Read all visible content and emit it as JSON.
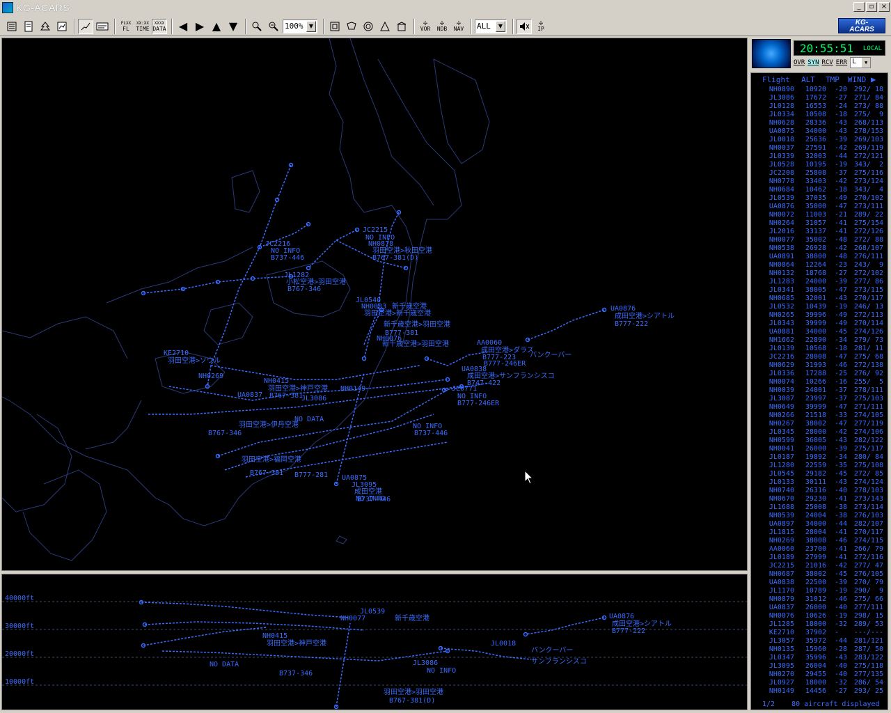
{
  "window": {
    "title": "KG-ACARS",
    "minimize": "_",
    "maximize": "▫",
    "close": "×"
  },
  "toolbar": {
    "fl_label": "FL",
    "fl_top": "FLXX",
    "time_label": "TIME",
    "time_top": "XX:XX",
    "data_label": "DATA",
    "data_top": "XXXX",
    "zoom_value": "100%",
    "filter_value": "ALL",
    "vor_label": "VOR",
    "ndb_label": "NDB",
    "nav_label": "NAV",
    "ip_label": "IP"
  },
  "logo": {
    "line1": "KG-",
    "line2": "ACARS"
  },
  "clock": {
    "time": "20:55:51",
    "mode": "LOCAL"
  },
  "status": {
    "ovr": "OVR",
    "syn": "SYN",
    "rcv": "RCV",
    "err": "ERR",
    "level": "L"
  },
  "flight_list": {
    "headers": {
      "flight": "Flight",
      "alt": "ALT",
      "tmp": "TMP",
      "wind": "WIND"
    },
    "rows": [
      [
        "NH0890",
        "10920",
        "-20",
        "292/ 18"
      ],
      [
        "JL3086",
        "17672",
        "-27",
        "271/ 84"
      ],
      [
        "JL0128",
        "16553",
        "-24",
        "273/ 88"
      ],
      [
        "JL0334",
        "10508",
        "-18",
        "275/  9"
      ],
      [
        "NH0628",
        "28336",
        "-43",
        "268/113"
      ],
      [
        "UA0875",
        "34000",
        "-43",
        "278/153"
      ],
      [
        "JL0018",
        "25636",
        "-39",
        "269/103"
      ],
      [
        "NH0037",
        "27591",
        "-42",
        "269/119"
      ],
      [
        "JL0339",
        "32003",
        "-44",
        "272/121"
      ],
      [
        "JL0528",
        "10195",
        "-19",
        "343/  2"
      ],
      [
        "JC2208",
        "25808",
        "-37",
        "275/116"
      ],
      [
        "NH0778",
        "33403",
        "-42",
        "273/124"
      ],
      [
        "NH0684",
        "10462",
        "-18",
        "343/  4"
      ],
      [
        "JL0539",
        "37035",
        "-49",
        "270/102"
      ],
      [
        "UA0876",
        "35000",
        "-47",
        "273/111"
      ],
      [
        "NH0072",
        "11003",
        "-21",
        "289/ 22"
      ],
      [
        "NH0264",
        "31057",
        "-41",
        "275/154"
      ],
      [
        "JL2016",
        "33137",
        "-41",
        "272/126"
      ],
      [
        "NH0077",
        "35002",
        "-48",
        "272/ 88"
      ],
      [
        "NH0538",
        "26928",
        "-42",
        "268/107"
      ],
      [
        "UA0891",
        "38000",
        "-48",
        "276/111"
      ],
      [
        "NH0864",
        "12264",
        "-23",
        "243/  9"
      ],
      [
        "NH0132",
        "18768",
        "-27",
        "272/102"
      ],
      [
        "JL1283",
        "24000",
        "-39",
        "277/ 86"
      ],
      [
        "JL0341",
        "38005",
        "-47",
        "273/115"
      ],
      [
        "NH0685",
        "32001",
        "-43",
        "270/117"
      ],
      [
        "JL0532",
        "10439",
        "-19",
        "246/ 13"
      ],
      [
        "NH0265",
        "39996",
        "-49",
        "272/113"
      ],
      [
        "JL0343",
        "39999",
        "-49",
        "270/114"
      ],
      [
        "UA0881",
        "34000",
        "-45",
        "274/126"
      ],
      [
        "NH1662",
        "22890",
        "-34",
        "279/ 73"
      ],
      [
        "JL0139",
        "10568",
        "-18",
        "281/ 11"
      ],
      [
        "JC2216",
        "28008",
        "-47",
        "275/ 68"
      ],
      [
        "NH0629",
        "31993",
        "-46",
        "272/138"
      ],
      [
        "JL0336",
        "17288",
        "-25",
        "276/ 92"
      ],
      [
        "NH0074",
        "10266",
        "-16",
        "255/  5"
      ],
      [
        "NH0039",
        "24001",
        "-37",
        "278/111"
      ],
      [
        "JL3087",
        "23997",
        "-37",
        "275/103"
      ],
      [
        "NH0649",
        "39999",
        "-47",
        "271/111"
      ],
      [
        "NH0266",
        "21518",
        "-33",
        "274/105"
      ],
      [
        "NH0267",
        "38002",
        "-47",
        "277/119"
      ],
      [
        "JL0345",
        "28000",
        "-42",
        "274/106"
      ],
      [
        "NH0599",
        "36005",
        "-43",
        "282/122"
      ],
      [
        "NH0041",
        "26000",
        "-39",
        "275/117"
      ],
      [
        "JL0187",
        "19892",
        "-34",
        "280/ 84"
      ],
      [
        "JL1280",
        "22559",
        "-35",
        "275/108"
      ],
      [
        "JL0545",
        "29182",
        "-45",
        "272/ 85"
      ],
      [
        "JL0133",
        "30111",
        "-43",
        "274/124"
      ],
      [
        "NH0740",
        "26316",
        "-40",
        "278/103"
      ],
      [
        "NH0670",
        "29230",
        "-41",
        "273/143"
      ],
      [
        "JL1688",
        "25008",
        "-38",
        "273/114"
      ],
      [
        "NH0539",
        "24004",
        "-38",
        "276/103"
      ],
      [
        "UA0897",
        "34000",
        "-44",
        "282/107"
      ],
      [
        "JL1815",
        "28004",
        "-41",
        "270/117"
      ],
      [
        "NH0269",
        "38008",
        "-46",
        "274/115"
      ],
      [
        "AA0060",
        "23700",
        "-41",
        "266/ 79"
      ],
      [
        "JL0189",
        "27999",
        "-41",
        "272/116"
      ],
      [
        "JC2215",
        "21016",
        "-42",
        "277/ 47"
      ],
      [
        "NH0687",
        "38002",
        "-45",
        "276/105"
      ],
      [
        "UA0838",
        "22500",
        "-39",
        "270/ 79"
      ],
      [
        "JL1170",
        "10789",
        "-19",
        "290/  9"
      ],
      [
        "NH0879",
        "31012",
        "-46",
        "275/ 66"
      ],
      [
        "UA0837",
        "26000",
        "-40",
        "277/111"
      ],
      [
        "NH0076",
        "10626",
        "-19",
        "298/ 15"
      ],
      [
        "JL1285",
        "18000",
        "-32",
        "289/ 53"
      ],
      [
        "KE2710",
        "37902",
        "-  ",
        "---/---"
      ],
      [
        "JL3057",
        "35972",
        "-44",
        "281/121"
      ],
      [
        "NH0135",
        "15960",
        "-28",
        "287/ 50"
      ],
      [
        "JL0347",
        "35996",
        "-43",
        "283/122"
      ],
      [
        "JL3095",
        "26004",
        "-40",
        "275/118"
      ],
      [
        "NH0270",
        "29455",
        "-40",
        "277/135"
      ],
      [
        "JL0927",
        "18000",
        "-32",
        "286/ 54"
      ],
      [
        "NH0149",
        "14456",
        "-27",
        "293/ 25"
      ]
    ],
    "footer": "1/2    80 aircraft displayed"
  },
  "map": {
    "labels": [
      {
        "t": "JC2216"
      },
      {
        "t": "NO INFO"
      },
      {
        "t": "B737-446"
      },
      {
        "t": "JC2215"
      },
      {
        "t": "NO INFO"
      },
      {
        "t": "NH0878"
      },
      {
        "t": "羽田空港>秋田空港"
      },
      {
        "t": "B767-381(D)"
      },
      {
        "t": "JL1282"
      },
      {
        "t": "小松空港>羽田空港"
      },
      {
        "t": "B767-346"
      },
      {
        "t": "JL0540"
      },
      {
        "t": "NH0083"
      },
      {
        "t": "新千歳空港"
      },
      {
        "t": "羽田空港>新千歳空港"
      },
      {
        "t": "新千歳空港>羽田空港"
      },
      {
        "t": "B777-381"
      },
      {
        "t": "NH0076"
      },
      {
        "t": "新千歳空港>羽田空港"
      },
      {
        "t": "UA0876"
      },
      {
        "t": "成田空港>シアトル"
      },
      {
        "t": "B777-222"
      },
      {
        "t": "AA0060"
      },
      {
        "t": "成田空港>ダラス"
      },
      {
        "t": "B777-223"
      },
      {
        "t": "バンクーバー"
      },
      {
        "t": "B777-246ER"
      },
      {
        "t": "UA0838"
      },
      {
        "t": "成田空港>サンフランシスコ"
      },
      {
        "t": "B747-422"
      },
      {
        "t": "JL0771"
      },
      {
        "t": "NO INFO"
      },
      {
        "t": "B777-246ER"
      },
      {
        "t": "NH0269"
      },
      {
        "t": "NH0415"
      },
      {
        "t": "羽田空港>神戸空港"
      },
      {
        "t": "B767-381"
      },
      {
        "t": "NH0149"
      },
      {
        "t": "KE2710"
      },
      {
        "t": "羽田空港>ソウル"
      },
      {
        "t": "UA0837"
      },
      {
        "t": "NO DATA"
      },
      {
        "t": "JL3086"
      },
      {
        "t": "NO INFO"
      },
      {
        "t": "B737-446"
      },
      {
        "t": "羽田空港>伊丹空港"
      },
      {
        "t": "B767-346"
      },
      {
        "t": "羽田空港>福岡空港"
      },
      {
        "t": "B767-381"
      },
      {
        "t": "B777-281"
      },
      {
        "t": "UA0875"
      },
      {
        "t": "JL3095"
      },
      {
        "t": "成田空港"
      },
      {
        "t": "NO INFO"
      },
      {
        "t": "B737-446"
      }
    ]
  },
  "profile": {
    "axis": [
      "40000ft",
      "30000ft",
      "20000ft",
      "10000ft"
    ],
    "labels": [
      {
        "t": "UA0876"
      },
      {
        "t": "成田空港>シアトル"
      },
      {
        "t": "B777-222"
      },
      {
        "t": "JL0539"
      },
      {
        "t": "NH0077"
      },
      {
        "t": "新千歳空港"
      },
      {
        "t": "NH0415"
      },
      {
        "t": "羽田空港>神戸空港"
      },
      {
        "t": "JL0018"
      },
      {
        "t": "バンクーバー"
      },
      {
        "t": "サンフランシスコ"
      },
      {
        "t": "JL3086"
      },
      {
        "t": "NO INFO"
      },
      {
        "t": "NO DATA"
      },
      {
        "t": "B737-346"
      },
      {
        "t": "羽田空港>羽田空港"
      },
      {
        "t": "B767-381(D)"
      }
    ]
  },
  "colors": {
    "primary": "#3a6cff",
    "coast": "#2a3a78",
    "clock": "#00ff66"
  }
}
